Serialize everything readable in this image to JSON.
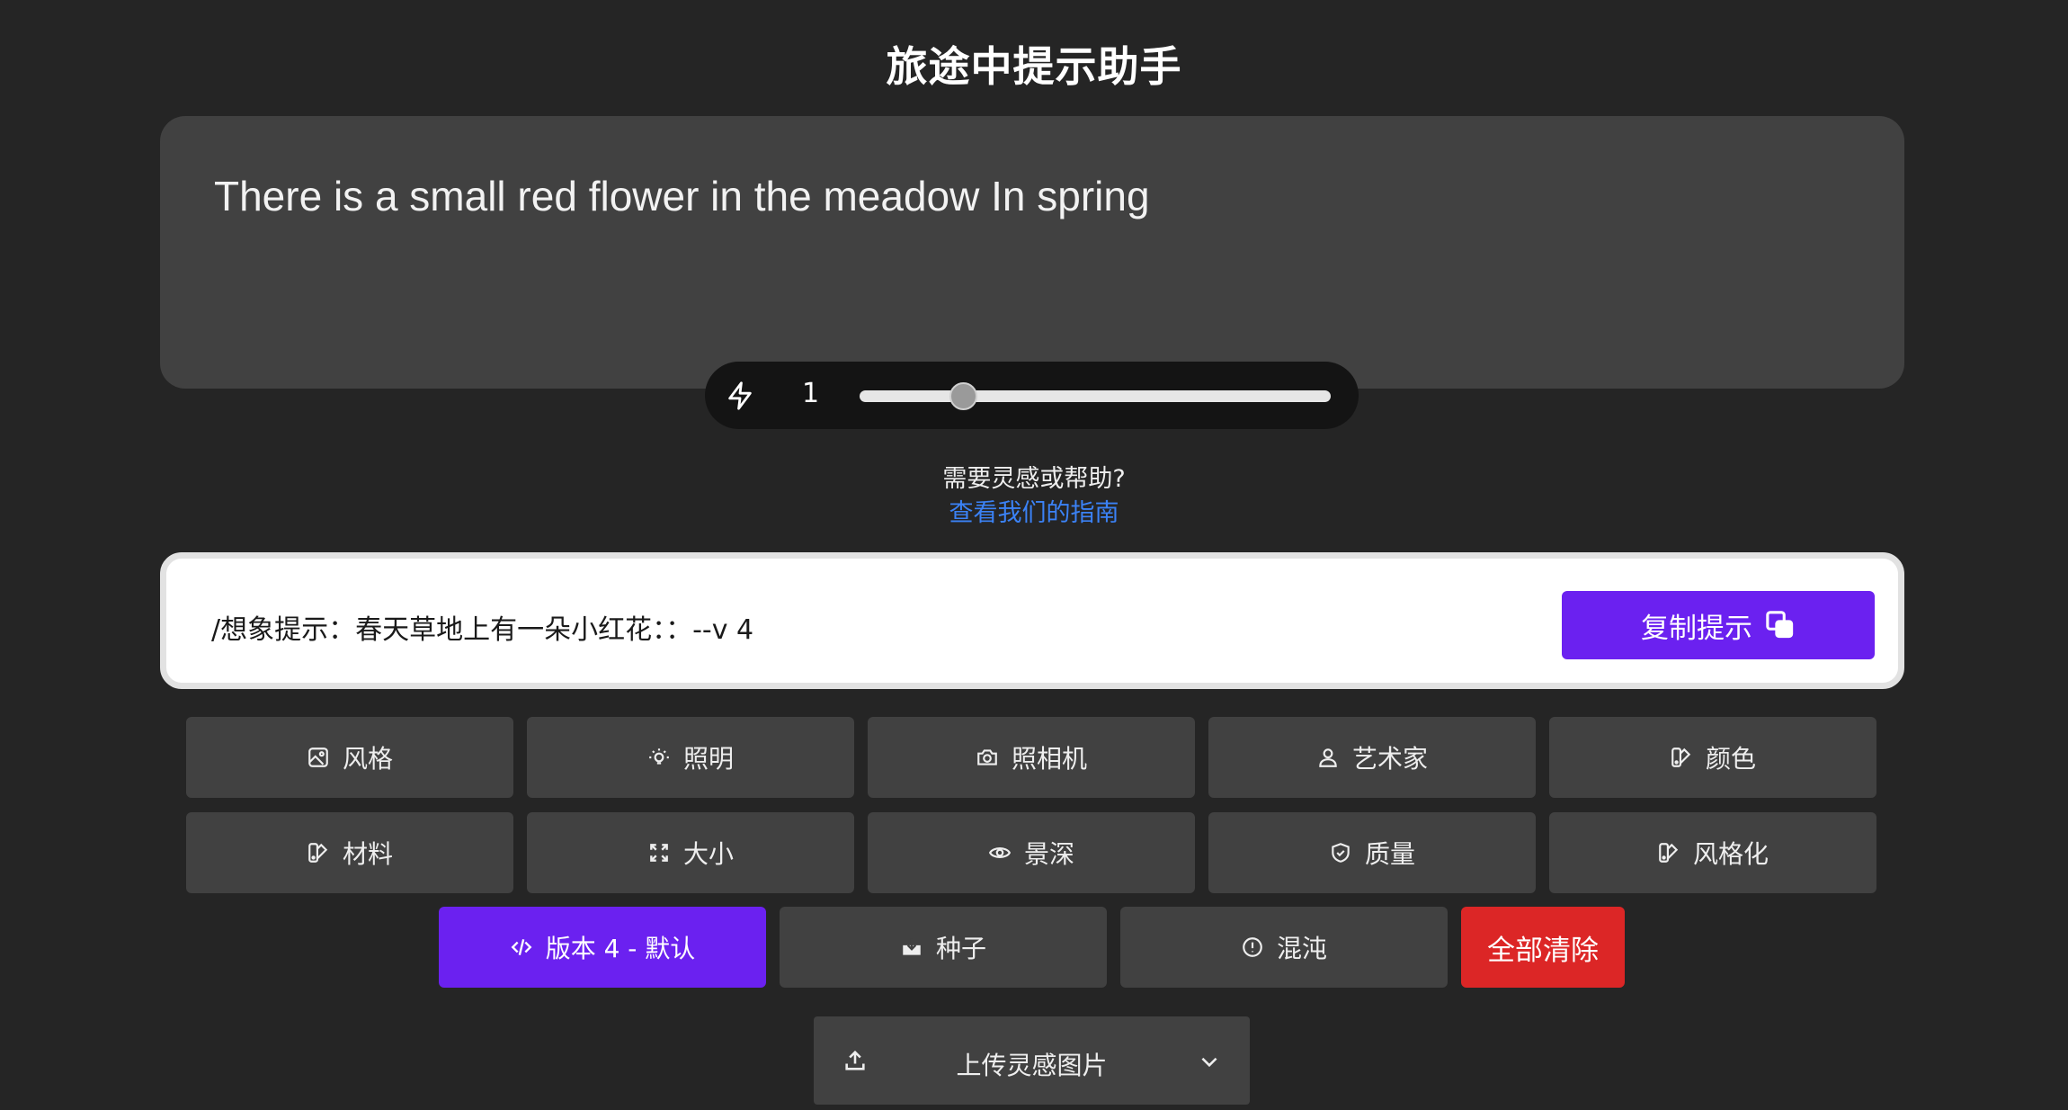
{
  "header": {
    "title": "旅途中提示助手"
  },
  "prompt": {
    "text": "There is a small red flower in the meadow In spring"
  },
  "weight": {
    "value": "1",
    "level": 0.22
  },
  "help": {
    "question": "需要灵感或帮助?",
    "link": "查看我们的指南"
  },
  "output": {
    "text": "/想象提示：春天草地上有一朵小红花：：--v 4",
    "copy_label": "复制提示"
  },
  "options": {
    "row1": [
      "风格",
      "照明",
      "照相机",
      "艺术家",
      "颜色"
    ],
    "row2": [
      "材料",
      "大小",
      "景深",
      "质量",
      "风格化"
    ],
    "row3": [
      "版本 4 - 默认",
      "种子",
      "混沌",
      "全部清除"
    ]
  },
  "upload": {
    "label": "上传灵感图片"
  },
  "colors": {
    "accent": "#6b21f0",
    "danger": "#dc2626",
    "link": "#3b82f6",
    "panel": "#414141",
    "background": "#252525"
  }
}
